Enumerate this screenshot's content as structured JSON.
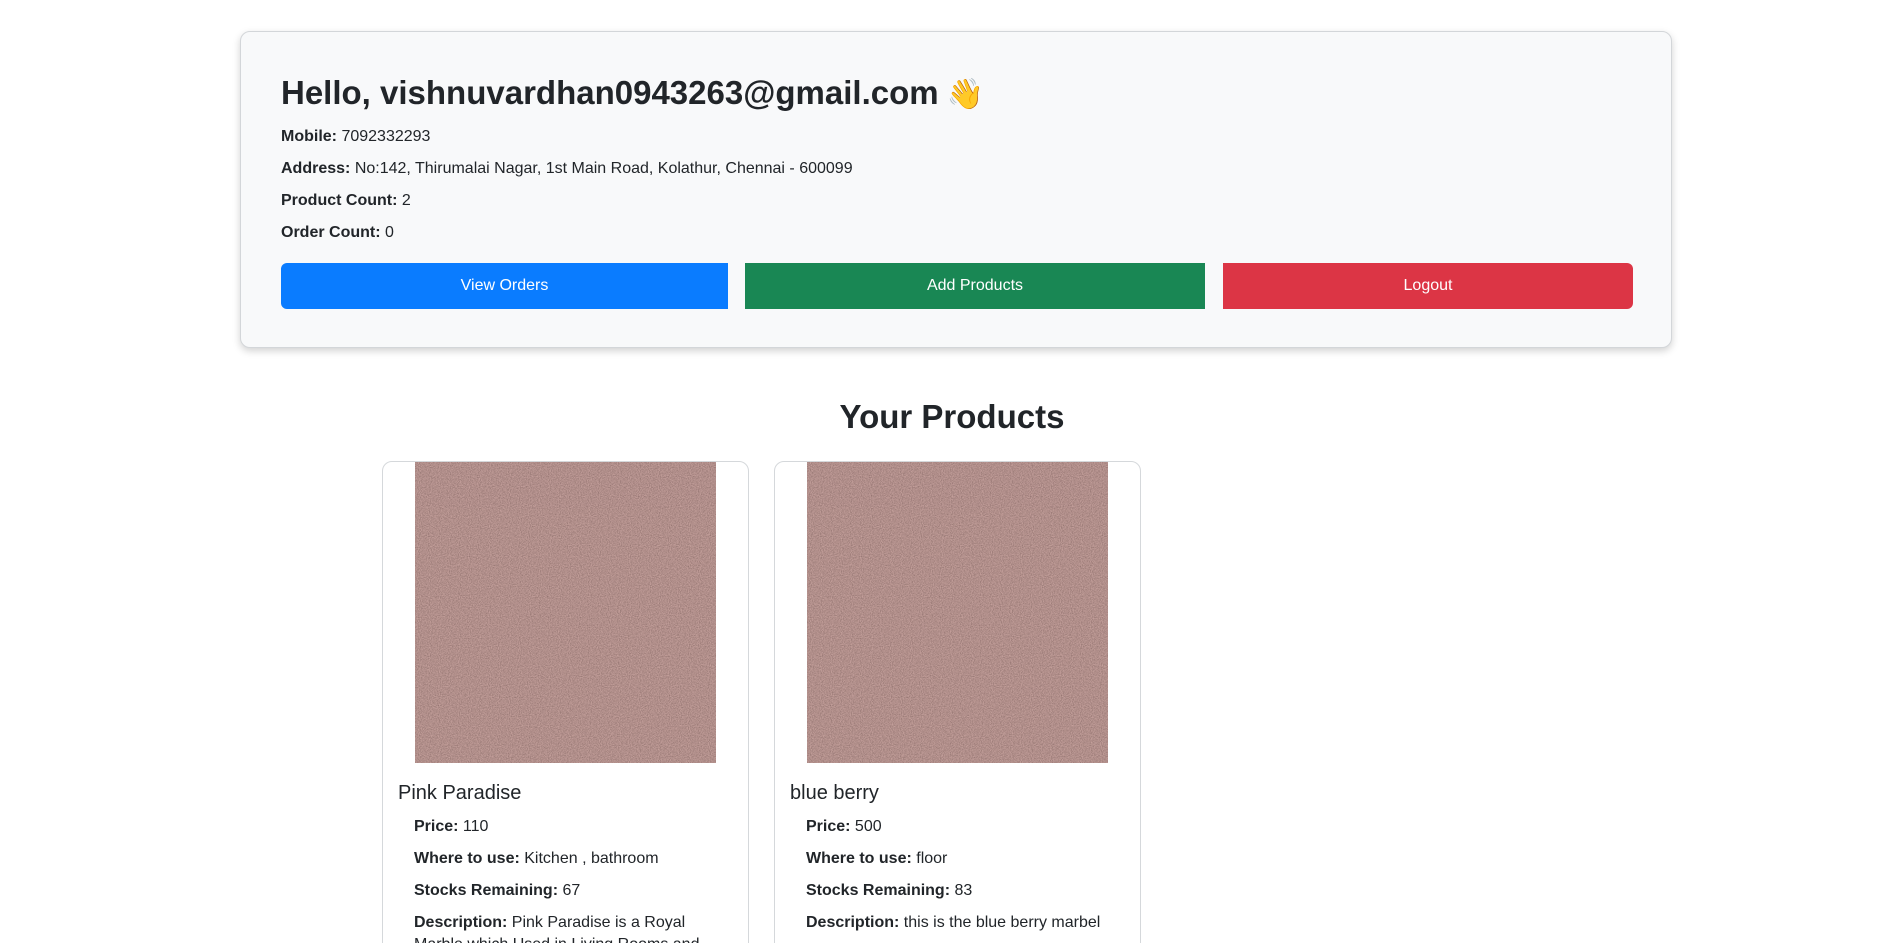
{
  "profile": {
    "greeting": "Hello, vishnuvardhan0943263@gmail.com",
    "wave_emoji": "👋",
    "mobile_label": "Mobile:",
    "mobile_value": "7092332293",
    "address_label": "Address:",
    "address_value": "No:142, Thirumalai Nagar, 1st Main Road, Kolathur, Chennai - 600099",
    "product_count_label": "Product Count:",
    "product_count_value": "2",
    "order_count_label": "Order Count:",
    "order_count_value": "0"
  },
  "actions": {
    "view_orders": "View Orders",
    "add_products": "Add Products",
    "logout": "Logout"
  },
  "products_section": {
    "title": "Your Products",
    "items": [
      {
        "name": "Pink Paradise",
        "price_label": "Price:",
        "price": "110",
        "use_label": "Where to use:",
        "use": "Kitchen , bathroom",
        "stock_label": "Stocks Remaining:",
        "stock": "67",
        "desc_label": "Description:",
        "desc": "Pink Paradise is a Royal Marble which Used in Living Rooms and"
      },
      {
        "name": "blue berry",
        "price_label": "Price:",
        "price": "500",
        "use_label": "Where to use:",
        "use": "floor",
        "stock_label": "Stocks Remaining:",
        "stock": "83",
        "desc_label": "Description:",
        "desc": "this is the blue berry marbel"
      }
    ]
  },
  "colors": {
    "primary": "#0a7cff",
    "success": "#198754",
    "danger": "#dc3545",
    "marble_base": "#7c5552"
  }
}
